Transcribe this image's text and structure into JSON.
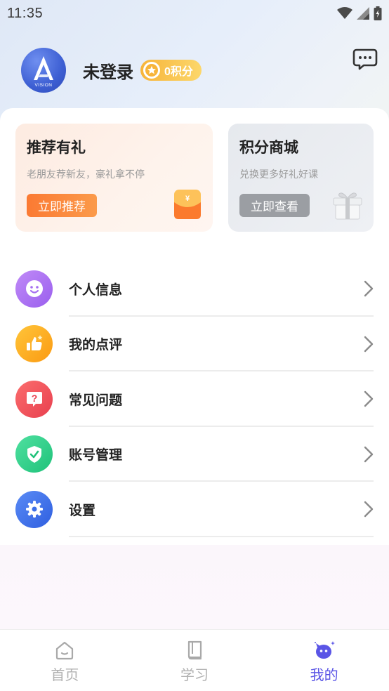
{
  "status_bar": {
    "time": "11:35",
    "icons": [
      "wifi-icon",
      "signal-icon",
      "battery-icon"
    ]
  },
  "profile": {
    "username": "未登录",
    "points_badge": "0积分",
    "avatar_logo_text": "VISION"
  },
  "header": {
    "message_icon": "message-icon"
  },
  "promos": [
    {
      "title": "推荐有礼",
      "subtitle": "老朋友荐新友，豪礼拿不停",
      "button": "立即推荐",
      "icon": "red-envelope-icon",
      "accent": "#fb7a33"
    },
    {
      "title": "积分商城",
      "subtitle": "兑换更多好礼好课",
      "button": "立即查看",
      "icon": "gift-box-icon",
      "accent": "#9b9ea3"
    }
  ],
  "menu": {
    "items": [
      {
        "label": "个人信息",
        "icon": "smile-face-icon",
        "color": "#a56ef0"
      },
      {
        "label": "我的点评",
        "icon": "thumbs-up-icon",
        "color": "#fbaa1a"
      },
      {
        "label": "常见问题",
        "icon": "question-icon",
        "color": "#f0505f"
      },
      {
        "label": "账号管理",
        "icon": "shield-check-icon",
        "color": "#2ed18a"
      },
      {
        "label": "设置",
        "icon": "gear-icon",
        "color": "#3c6fe8"
      }
    ]
  },
  "tab_bar": {
    "tabs": [
      {
        "label": "首页",
        "icon": "home-icon",
        "active": false
      },
      {
        "label": "学习",
        "icon": "book-icon",
        "active": false
      },
      {
        "label": "我的",
        "icon": "mascot-icon",
        "active": true
      }
    ],
    "active_color": "#5a55e6",
    "inactive_color": "#b0b0b0"
  }
}
